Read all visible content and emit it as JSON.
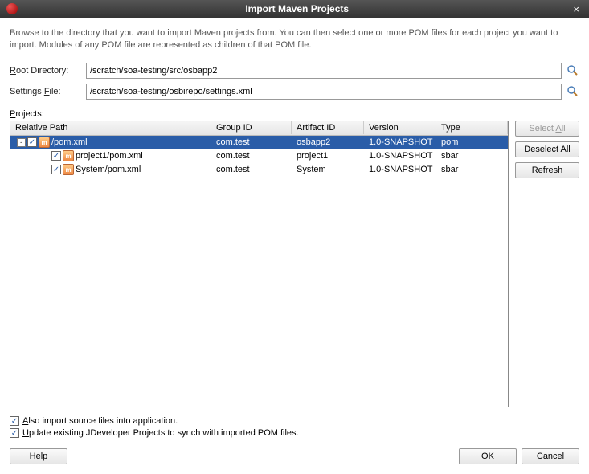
{
  "titlebar": {
    "title": "Import Maven Projects"
  },
  "description": "Browse to the directory that you want to import Maven projects from. You can then select one or more POM files for each project you want to import. Modules of any POM file are represented as children of that POM file.",
  "form": {
    "root_dir_label_prefix": "R",
    "root_dir_label_rest": "oot Directory:",
    "root_dir_value": "/scratch/soa-testing/src/osbapp2",
    "settings_file_label_prefix": "Settings ",
    "settings_file_label_char": "F",
    "settings_file_label_rest": "ile:",
    "settings_file_value": "/scratch/soa-testing/osbirepo/settings.xml",
    "projects_label_char": "P",
    "projects_label_rest": "rojects:"
  },
  "columns": {
    "path": "Relative Path",
    "group": "Group ID",
    "artifact": "Artifact ID",
    "version": "Version",
    "type": "Type"
  },
  "rows": [
    {
      "indent": 0,
      "expander": "-",
      "checked": true,
      "path": "/pom.xml",
      "group": "com.test",
      "artifact": "osbapp2",
      "version": "1.0-SNAPSHOT",
      "type": "pom",
      "selected": true
    },
    {
      "indent": 1,
      "expander": "",
      "checked": true,
      "path": "project1/pom.xml",
      "group": "com.test",
      "artifact": "project1",
      "version": "1.0-SNAPSHOT",
      "type": "sbar",
      "selected": false
    },
    {
      "indent": 1,
      "expander": "",
      "checked": true,
      "path": "System/pom.xml",
      "group": "com.test",
      "artifact": "System",
      "version": "1.0-SNAPSHOT",
      "type": "sbar",
      "selected": false
    }
  ],
  "side": {
    "select_all_char": "A",
    "select_all_prefix": "Select ",
    "select_all_rest": "ll",
    "deselect_all_char": "e",
    "deselect_all_prefix": "D",
    "deselect_all_rest": "select All",
    "refresh_char": "s",
    "refresh_prefix": "Refre",
    "refresh_rest": "h"
  },
  "opts": {
    "also_import_char": "A",
    "also_import_rest": "lso import source files into application.",
    "update_char": "U",
    "update_rest": "pdate existing JDeveloper Projects to synch with imported POM files."
  },
  "footer": {
    "help_char": "H",
    "help_rest": "elp",
    "ok": "OK",
    "cancel": "Cancel"
  }
}
